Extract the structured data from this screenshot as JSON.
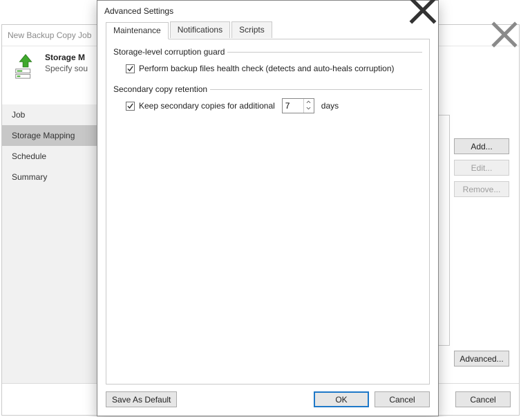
{
  "wizard": {
    "window_title": "New Backup Copy Job",
    "page_title": "Storage M",
    "page_subtitle": "Specify sou",
    "nav": [
      {
        "label": "Job",
        "selected": false
      },
      {
        "label": "Storage Mapping",
        "selected": true
      },
      {
        "label": "Schedule",
        "selected": false
      },
      {
        "label": "Summary",
        "selected": false
      }
    ],
    "buttons": {
      "add": "Add...",
      "edit": "Edit...",
      "remove": "Remove...",
      "advanced": "Advanced...",
      "cancel": "Cancel"
    }
  },
  "dialog": {
    "title": "Advanced Settings",
    "tabs": {
      "maintenance": "Maintenance",
      "notifications": "Notifications",
      "scripts": "Scripts"
    },
    "storage_guard": {
      "legend": "Storage-level corruption guard",
      "checkbox_label": "Perform backup files health check (detects and auto-heals corruption)",
      "checked": true
    },
    "secondary_retention": {
      "legend": "Secondary copy retention",
      "checkbox_label_pre": "Keep secondary copies for additional",
      "checkbox_label_post": "days",
      "checked": true,
      "value": "7"
    },
    "buttons": {
      "save_default": "Save As Default",
      "ok": "OK",
      "cancel": "Cancel"
    }
  }
}
